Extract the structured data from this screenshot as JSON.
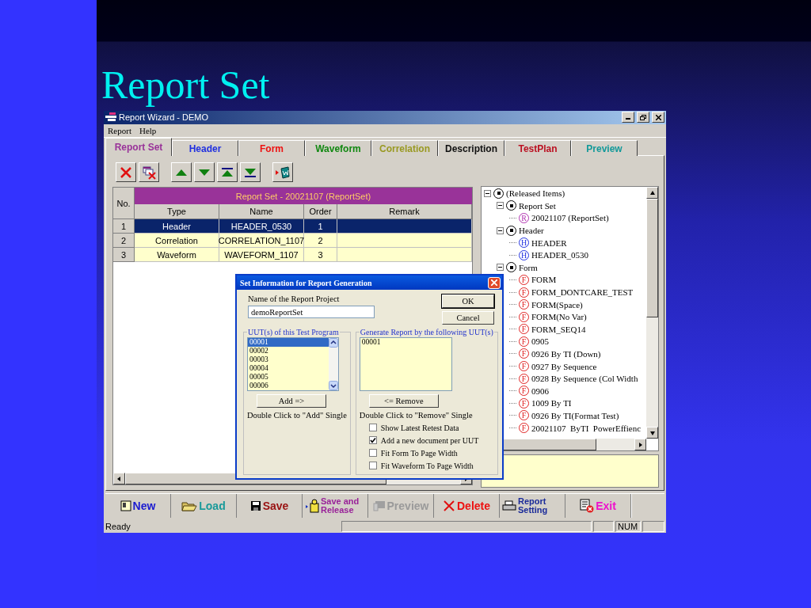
{
  "slide": {
    "title": "Report Set"
  },
  "window": {
    "title": "Report Wizard - DEMO"
  },
  "menu": [
    "Report",
    "Help"
  ],
  "tabs": [
    {
      "label": "Report Set",
      "color": "#993399",
      "selected": true
    },
    {
      "label": "Header",
      "color": "#1f2fe0",
      "selected": false
    },
    {
      "label": "Form",
      "color": "#ee1111",
      "selected": false
    },
    {
      "label": "Waveform",
      "color": "#118811",
      "selected": false
    },
    {
      "label": "Correlation",
      "color": "#999922",
      "selected": false
    },
    {
      "label": "Description",
      "color": "#111111",
      "selected": false
    },
    {
      "label": "TestPlan",
      "color": "#bb1122",
      "selected": false
    },
    {
      "label": "Preview",
      "color": "#119999",
      "selected": false
    }
  ],
  "toolbar": [
    {
      "kind": "delete"
    },
    {
      "kind": "delete-all"
    },
    {
      "kind": "up"
    },
    {
      "kind": "down"
    },
    {
      "kind": "top"
    },
    {
      "kind": "bottom"
    },
    {
      "kind": "export"
    }
  ],
  "grid": {
    "title": "Report Set - 20021107 (ReportSet)",
    "no_header": "No.",
    "columns": [
      "Type",
      "Name",
      "Order",
      "Remark"
    ],
    "rows": [
      {
        "no": "1",
        "type": "Header",
        "name": "HEADER_0530",
        "order": "1",
        "selected": true
      },
      {
        "no": "2",
        "type": "Correlation",
        "name": "CORRELATION_1107",
        "order": "2",
        "selected": false
      },
      {
        "no": "3",
        "type": "Waveform",
        "name": "WAVEFORM_1107",
        "order": "3",
        "selected": false
      }
    ]
  },
  "tree": [
    {
      "label": "(Released Items)",
      "kind": "group",
      "expanded": true,
      "children": [
        {
          "label": "Report Set",
          "kind": "group",
          "expanded": true,
          "children": [
            {
              "label": "20021107 (ReportSet)",
              "kind": "report",
              "badge": "R"
            }
          ]
        },
        {
          "label": "Header",
          "kind": "group",
          "expanded": true,
          "children": [
            {
              "label": "HEADER",
              "kind": "header",
              "badge": "H"
            },
            {
              "label": "HEADER_0530",
              "kind": "header",
              "badge": "H"
            }
          ]
        },
        {
          "label": "Form",
          "kind": "group",
          "expanded": true,
          "children": [
            {
              "label": "FORM",
              "kind": "form",
              "badge": "F"
            },
            {
              "label": "FORM_DONTCARE_TEST",
              "kind": "form",
              "badge": "F"
            },
            {
              "label": "FORM(Space)",
              "kind": "form",
              "badge": "F"
            },
            {
              "label": "FORM(No Var)",
              "kind": "form",
              "badge": "F"
            },
            {
              "label": "FORM_SEQ14",
              "kind": "form",
              "badge": "F"
            },
            {
              "label": "0905",
              "kind": "form",
              "badge": "F"
            },
            {
              "label": "0926 By TI (Down)",
              "kind": "form",
              "badge": "F"
            },
            {
              "label": "0927 By Sequence",
              "kind": "form",
              "badge": "F"
            },
            {
              "label": "0928 By Sequence (Col Width",
              "kind": "form",
              "badge": "F"
            },
            {
              "label": "0906",
              "kind": "form",
              "badge": "F"
            },
            {
              "label": "1009 By TI",
              "kind": "form",
              "badge": "F"
            },
            {
              "label": "0926 By TI(Format Test)",
              "kind": "form",
              "badge": "F"
            },
            {
              "label": "20021107  ByTI  PowerEffienc",
              "kind": "form",
              "badge": "F"
            }
          ]
        }
      ]
    }
  ],
  "actions": [
    {
      "label": "New",
      "kind": "new",
      "color": "#1a1ad0",
      "disabled": false
    },
    {
      "label": "Load",
      "kind": "load",
      "color": "#1a9a9a",
      "disabled": false
    },
    {
      "label": "Save",
      "kind": "save",
      "color": "#991111",
      "disabled": false
    },
    {
      "label": "Save and Release",
      "kind": "release",
      "color": "#992299",
      "disabled": false
    },
    {
      "label": "Preview",
      "kind": "preview",
      "disabled": true
    },
    {
      "label": "Delete",
      "kind": "delete",
      "color": "#ee1111",
      "disabled": false
    },
    {
      "label": "Report Setting",
      "kind": "print",
      "color": "#1a2a99",
      "disabled": false
    },
    {
      "label": "Exit",
      "kind": "exit",
      "color": "#ee11cc",
      "disabled": false
    }
  ],
  "status_bar": {
    "text": "Ready",
    "indicator": "NUM"
  },
  "dialog": {
    "title": "Set Information for Report Generation",
    "name_label": "Name of the Report Project",
    "name_value": "demoReportSet",
    "buttons": [
      "OK",
      "Cancel"
    ],
    "left": {
      "title": "UUT(s) of this Test Program",
      "items": [
        {
          "label": "00001",
          "selected": true
        },
        {
          "label": "00002",
          "selected": false
        },
        {
          "label": "00003",
          "selected": false
        },
        {
          "label": "00004",
          "selected": false
        },
        {
          "label": "00005",
          "selected": false
        },
        {
          "label": "00006",
          "selected": false
        }
      ],
      "button": "Add =>",
      "hint": "Double Click to \"Add\" Single"
    },
    "right": {
      "title": "Generate Report by the following UUT(s)",
      "items": [
        {
          "label": "00001",
          "selected": false
        }
      ],
      "button": "<= Remove",
      "hint": "Double Click to \"Remove\" Single"
    },
    "options": [
      {
        "label": "Show Latest Retest Data",
        "checked": false
      },
      {
        "label": "Add a new document per UUT",
        "checked": true
      },
      {
        "label": "Fit Form To Page Width",
        "checked": false
      },
      {
        "label": "Fit Waveform To Page Width",
        "checked": false
      }
    ]
  }
}
